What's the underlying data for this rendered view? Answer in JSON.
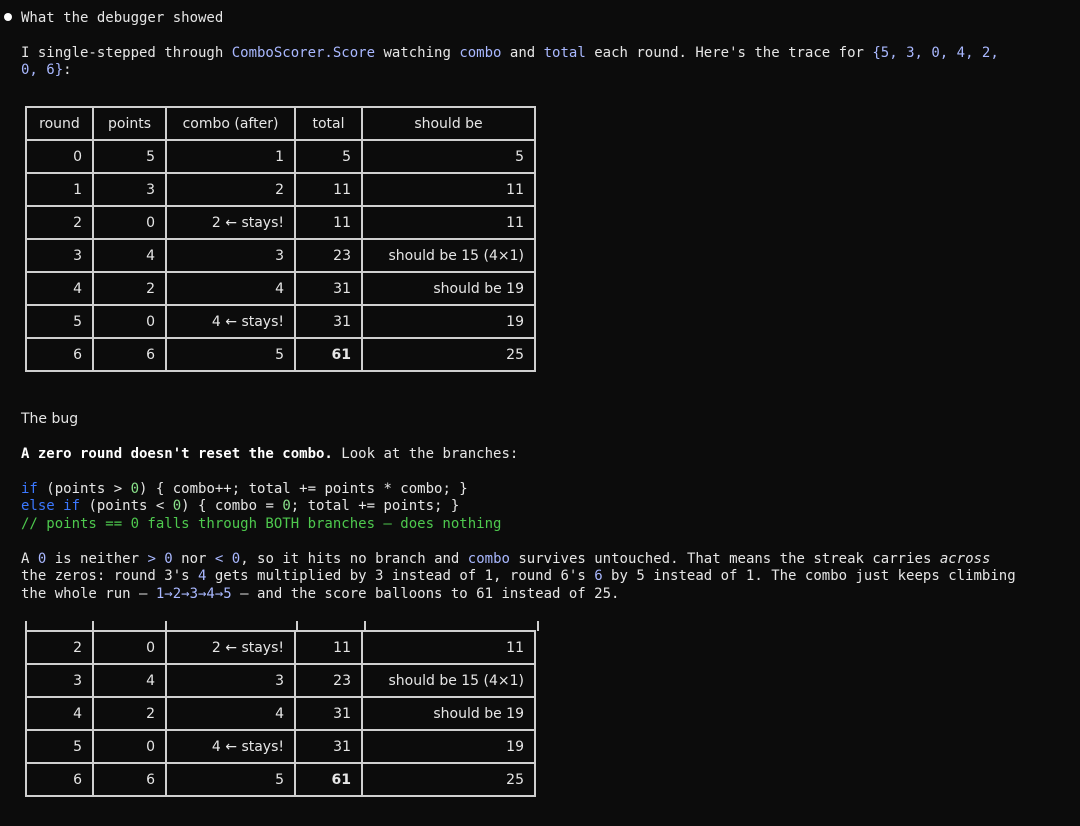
{
  "heading": "What the debugger showed",
  "intro": {
    "p1": "I single-stepped through ",
    "fn": "ComboScorer.Score",
    "p2": " watching ",
    "v1": "combo",
    "p3": " and ",
    "v2": "total",
    "p4": " each round. Here's the trace for ",
    "arr1": "{5, 3, 0, 4, 2,",
    "arr2": "0, 6}",
    "colon": ":"
  },
  "table": {
    "headers": [
      "round",
      "points",
      "combo (after)",
      "total",
      "should be"
    ],
    "rows": [
      [
        "0",
        "5",
        "1",
        "5",
        "5"
      ],
      [
        "1",
        "3",
        "2",
        "11",
        "11"
      ],
      [
        "2",
        "0",
        "2 ← stays!",
        "11",
        "11"
      ],
      [
        "3",
        "4",
        "3",
        "23",
        "should be 15 (4×1)"
      ],
      [
        "4",
        "2",
        "4",
        "31",
        "should be 19"
      ],
      [
        "5",
        "0",
        "4 ← stays!",
        "31",
        "19"
      ],
      [
        "6",
        "6",
        "5",
        "61",
        "25"
      ]
    ]
  },
  "bug_heading": "The bug",
  "bug_line": {
    "bold": "A zero round doesn't reset the combo.",
    "rest": " Look at the branches:"
  },
  "code": {
    "l1_kw": "if",
    "l1_a": " (points > ",
    "l1_n": "0",
    "l1_b": ") { combo++; total += points * combo; }",
    "l2_kw": "else if",
    "l2_a": " (points < ",
    "l2_n1": "0",
    "l2_b": ") { combo = ",
    "l2_n2": "0",
    "l2_c": "; total += points; }",
    "l3": "// points == 0 falls through BOTH branches — does nothing"
  },
  "explain": {
    "a": "A ",
    "z1": "0",
    "b": " is neither ",
    "c1": "> 0",
    "c": " nor ",
    "c2": "< 0",
    "d": ", so it hits no branch and ",
    "combo": "combo",
    "e": " survives untouched. That means the streak carries ",
    "across": "across",
    "l2a": "the zeros: round 3's ",
    "n4": "4",
    "l2b": " gets multiplied by 3 instead of 1, round 6's ",
    "n6": "6",
    "l2c": " by 5 instead of 1. The combo just keeps climbing",
    "l3a": "the whole run — ",
    "seq": "1→2→3→4→5",
    "l3b": " — and the score balloons to 61 instead of 25."
  },
  "table2": {
    "rows": [
      [
        "2",
        "0",
        "2 ← stays!",
        "11",
        "11"
      ],
      [
        "3",
        "4",
        "3",
        "23",
        "should be 15 (4×1)"
      ],
      [
        "4",
        "2",
        "4",
        "31",
        "should be 19"
      ],
      [
        "5",
        "0",
        "4 ← stays!",
        "31",
        "19"
      ],
      [
        "6",
        "6",
        "5",
        "61",
        "25"
      ]
    ]
  }
}
